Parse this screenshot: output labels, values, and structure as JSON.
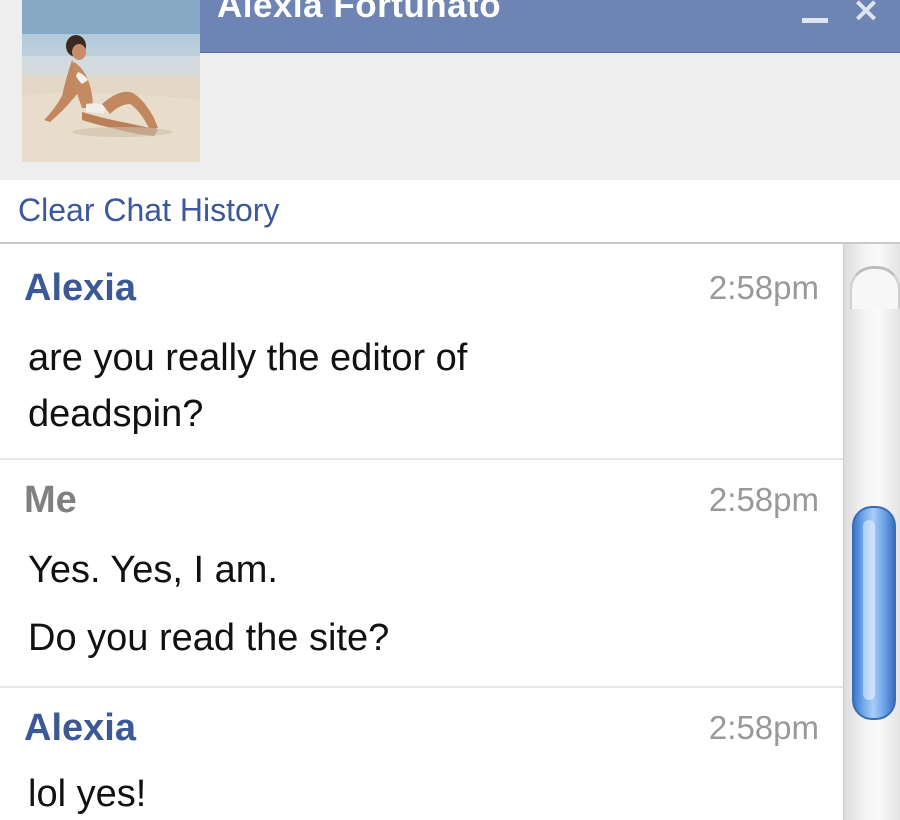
{
  "chat": {
    "contact_name": "Alexia Fortunato",
    "avatar_icon": "profile-photo-beach",
    "minimize_icon": "minimize-icon",
    "close_icon": "close-icon",
    "close_glyph": "×",
    "clear_history_label": "Clear Chat History"
  },
  "messages": [
    {
      "sender": "Alexia",
      "time": "2:58pm",
      "lines": [
        "are you really the editor of",
        "deadspin?"
      ]
    },
    {
      "sender": "Me",
      "time": "2:58pm",
      "lines": [
        "Yes. Yes, I am.",
        "Do you read the site?"
      ]
    },
    {
      "sender": "Alexia",
      "time": "2:58pm",
      "lines": [
        "lol yes!"
      ]
    }
  ],
  "colors": {
    "titlebar": "#6d84b4",
    "link": "#3b5998",
    "sender_other": "#3b5998",
    "sender_me": "#808080",
    "timestamp": "#999999",
    "scroll_thumb": "#6ea5e8"
  }
}
